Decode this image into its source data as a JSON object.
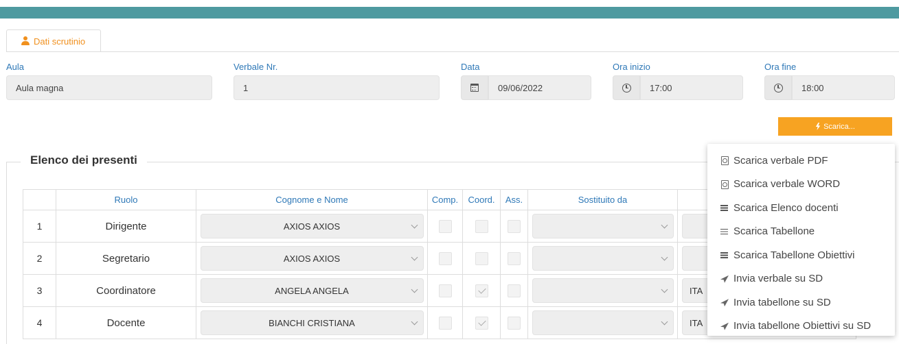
{
  "tab": {
    "label": "Dati scrutinio"
  },
  "form": {
    "aula": {
      "label": "Aula",
      "value": "Aula magna"
    },
    "verbale": {
      "label": "Verbale Nr.",
      "value": "1"
    },
    "data": {
      "label": "Data",
      "value": "09/06/2022"
    },
    "ora_inizio": {
      "label": "Ora inizio",
      "value": "17:00"
    },
    "ora_fine": {
      "label": "Ora fine",
      "value": "18:00"
    }
  },
  "scarica_button": {
    "label": "Scarica..."
  },
  "presenti": {
    "title": "Elenco dei presenti",
    "headers": [
      "",
      "Ruolo",
      "Cognome e Nome",
      "Comp.",
      "Coord.",
      "Ass.",
      "Sostituito da"
    ],
    "rows": [
      {
        "num": "1",
        "ruolo": "Dirigente",
        "nome": "AXIOS AXIOS",
        "comp": false,
        "coord": false,
        "ass": false,
        "sostituito": "",
        "extra": ""
      },
      {
        "num": "2",
        "ruolo": "Segretario",
        "nome": "AXIOS AXIOS",
        "comp": false,
        "coord": false,
        "ass": false,
        "sostituito": "",
        "extra": ""
      },
      {
        "num": "3",
        "ruolo": "Coordinatore",
        "nome": "ANGELA ANGELA",
        "comp": false,
        "coord": true,
        "ass": false,
        "sostituito": "",
        "extra": "ITA"
      },
      {
        "num": "4",
        "ruolo": "Docente",
        "nome": "BIANCHI CRISTIANA",
        "comp": false,
        "coord": true,
        "ass": false,
        "sostituito": "",
        "extra": "ITA"
      }
    ]
  },
  "menu": {
    "items": [
      {
        "label": "Scarica verbale PDF",
        "icon": "pdf-file-icon"
      },
      {
        "label": "Scarica verbale WORD",
        "icon": "word-file-icon"
      },
      {
        "label": "Scarica Elenco docenti",
        "icon": "list-icon"
      },
      {
        "label": "Scarica Tabellone",
        "icon": "list-icon"
      },
      {
        "label": "Scarica Tabellone Obiettivi",
        "icon": "list-icon"
      },
      {
        "label": "Invia verbale su SD",
        "icon": "send-icon"
      },
      {
        "label": "Invia tabellone su SD",
        "icon": "send-icon"
      },
      {
        "label": "Invia tabellone Obiettivi su SD",
        "icon": "send-icon"
      }
    ]
  },
  "colors": {
    "topbar": "#4e9aa0",
    "accent": "#f7a322",
    "label": "#2e78b7"
  }
}
